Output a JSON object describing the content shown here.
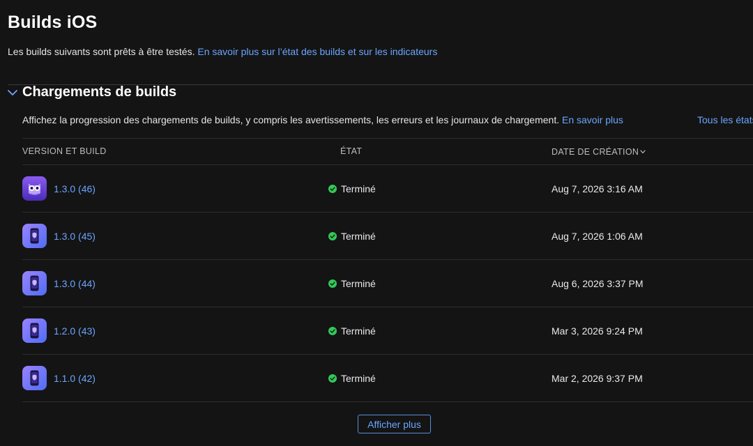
{
  "header": {
    "title": "Builds iOS",
    "subtitle": "Les builds suivants sont prêts à être testés.",
    "subtitle_link": "En savoir plus sur l’état des builds et sur les indicateurs"
  },
  "section": {
    "title": "Chargements de builds",
    "toggle_icon": "chevron-down-icon",
    "description": "Affichez la progression des chargements de builds, y compris les avertissements, les erreurs et les journaux de chargement.",
    "description_link": "En savoir plus",
    "filter_link": "Tous les états"
  },
  "table": {
    "columns": {
      "version": "VERSION ET BUILD",
      "status": "ÉTAT",
      "created": "DATE DE CRÉATION"
    },
    "rows": [
      {
        "icon": "owl-app-icon",
        "version": "1.3.0 (46)",
        "status": "Terminé",
        "created": "Aug 7, 2026 3:16 AM"
      },
      {
        "icon": "phone-shield-app-icon",
        "version": "1.3.0 (45)",
        "status": "Terminé",
        "created": "Aug 7, 2026 1:06 AM"
      },
      {
        "icon": "phone-shield-app-icon",
        "version": "1.3.0 (44)",
        "status": "Terminé",
        "created": "Aug 6, 2026 3:37 PM"
      },
      {
        "icon": "phone-shield-app-icon",
        "version": "1.2.0 (43)",
        "status": "Terminé",
        "created": "Mar 3, 2026 9:24 PM"
      },
      {
        "icon": "phone-shield-app-icon",
        "version": "1.1.0 (42)",
        "status": "Terminé",
        "created": "Mar 2, 2026 9:37 PM"
      }
    ]
  },
  "footer": {
    "show_more": "Afficher plus"
  },
  "colors": {
    "background": "#141414",
    "link": "#6aa6ff",
    "status_ok": "#34c759"
  }
}
